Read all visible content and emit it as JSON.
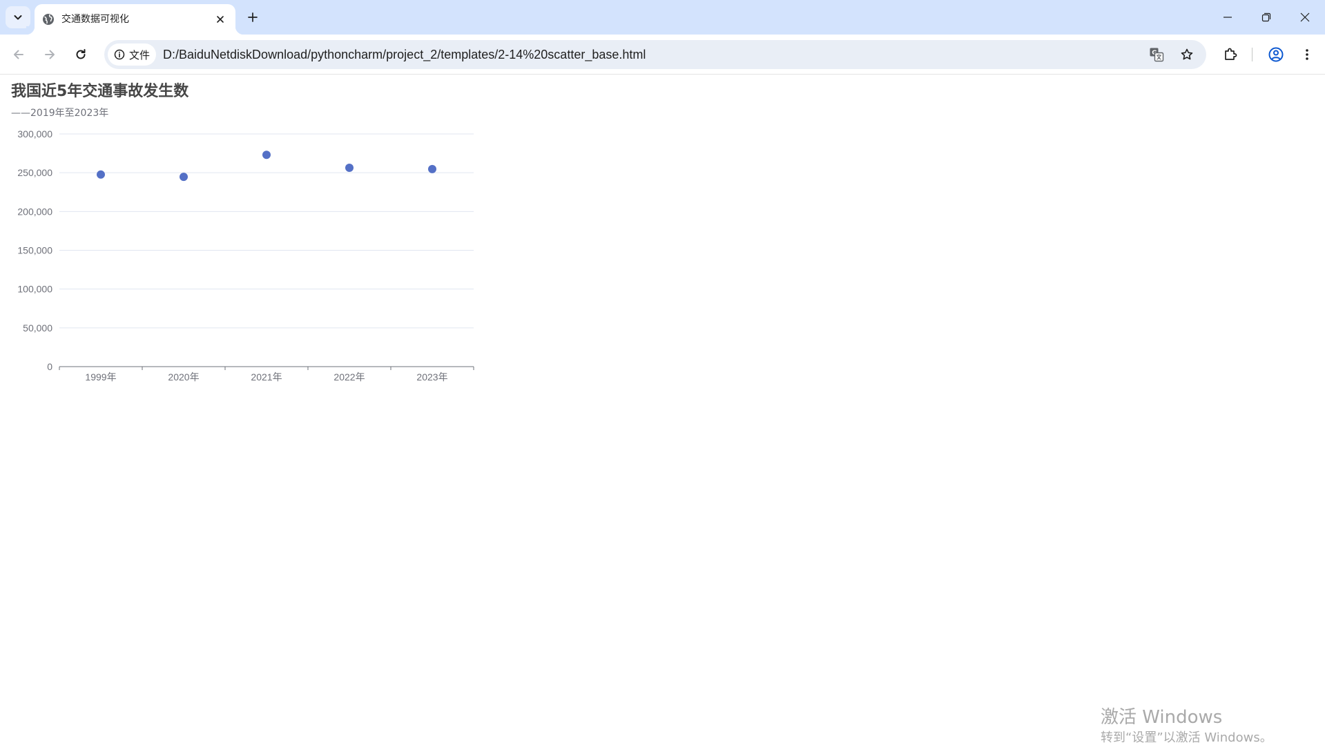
{
  "browser": {
    "tab": {
      "title": "交通数据可视化"
    },
    "address_bar": {
      "chip_label": "文件",
      "url": "D:/BaiduNetdiskDownload/pythoncharm/project_2/templates/2-14%20scatter_base.html"
    }
  },
  "page": {
    "title": "我国近5年交通事故发生数",
    "subtitle": "——2019年至2023年"
  },
  "chart_data": {
    "type": "scatter",
    "title": "我国近5年交通事故发生数",
    "subtitle": "——2019年至2023年",
    "categories": [
      "1999年",
      "2020年",
      "2021年",
      "2022年",
      "2023年"
    ],
    "values": [
      247646,
      244674,
      273098,
      256409,
      254703
    ],
    "y_ticks": [
      "0",
      "50,000",
      "100,000",
      "150,000",
      "200,000",
      "250,000",
      "300,000"
    ],
    "ylim": [
      0,
      300000
    ],
    "grid": true,
    "color": "#5470c6"
  },
  "watermark": {
    "line1": "激活 Windows",
    "line2": "转到“设置”以激活 Windows。"
  }
}
